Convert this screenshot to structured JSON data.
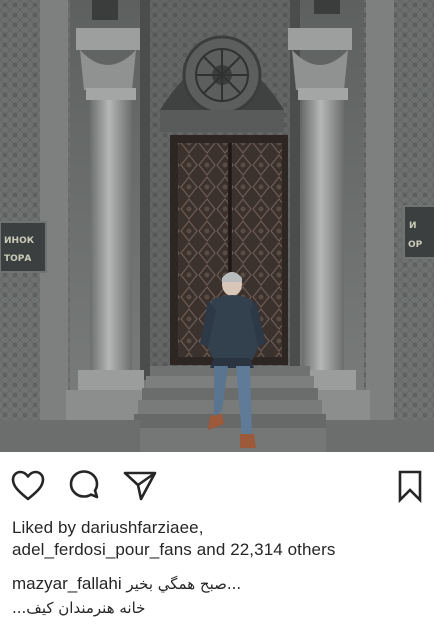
{
  "post": {
    "photo_signs": {
      "left": "НОК",
      "right_top": "ИНОК",
      "right_bottom": "ОРА"
    },
    "photo_signs_side": {
      "left_top": "ИНОК",
      "left_bottom": "ТОРА",
      "right_top": "И",
      "right_bottom": "ОР"
    },
    "actions": {
      "like_icon": "heart-icon",
      "comment_icon": "comment-icon",
      "share_icon": "send-icon",
      "save_icon": "bookmark-icon"
    },
    "likes": {
      "prefix": "Liked by ",
      "user1": "dariushfarziaee,",
      "user2": "adel_ferdosi_pour_fans",
      "middle": " and ",
      "count": "22,314 others"
    },
    "caption": {
      "username": "mazyar_fallahi",
      "text_line1": "صبح همگي بخير...",
      "text_line2": "خانه هنرمندان کيف..."
    },
    "colors": {
      "text": "#262626",
      "icon": "#262626",
      "stone": "#8a8d8c",
      "door": "#3e3430"
    }
  }
}
